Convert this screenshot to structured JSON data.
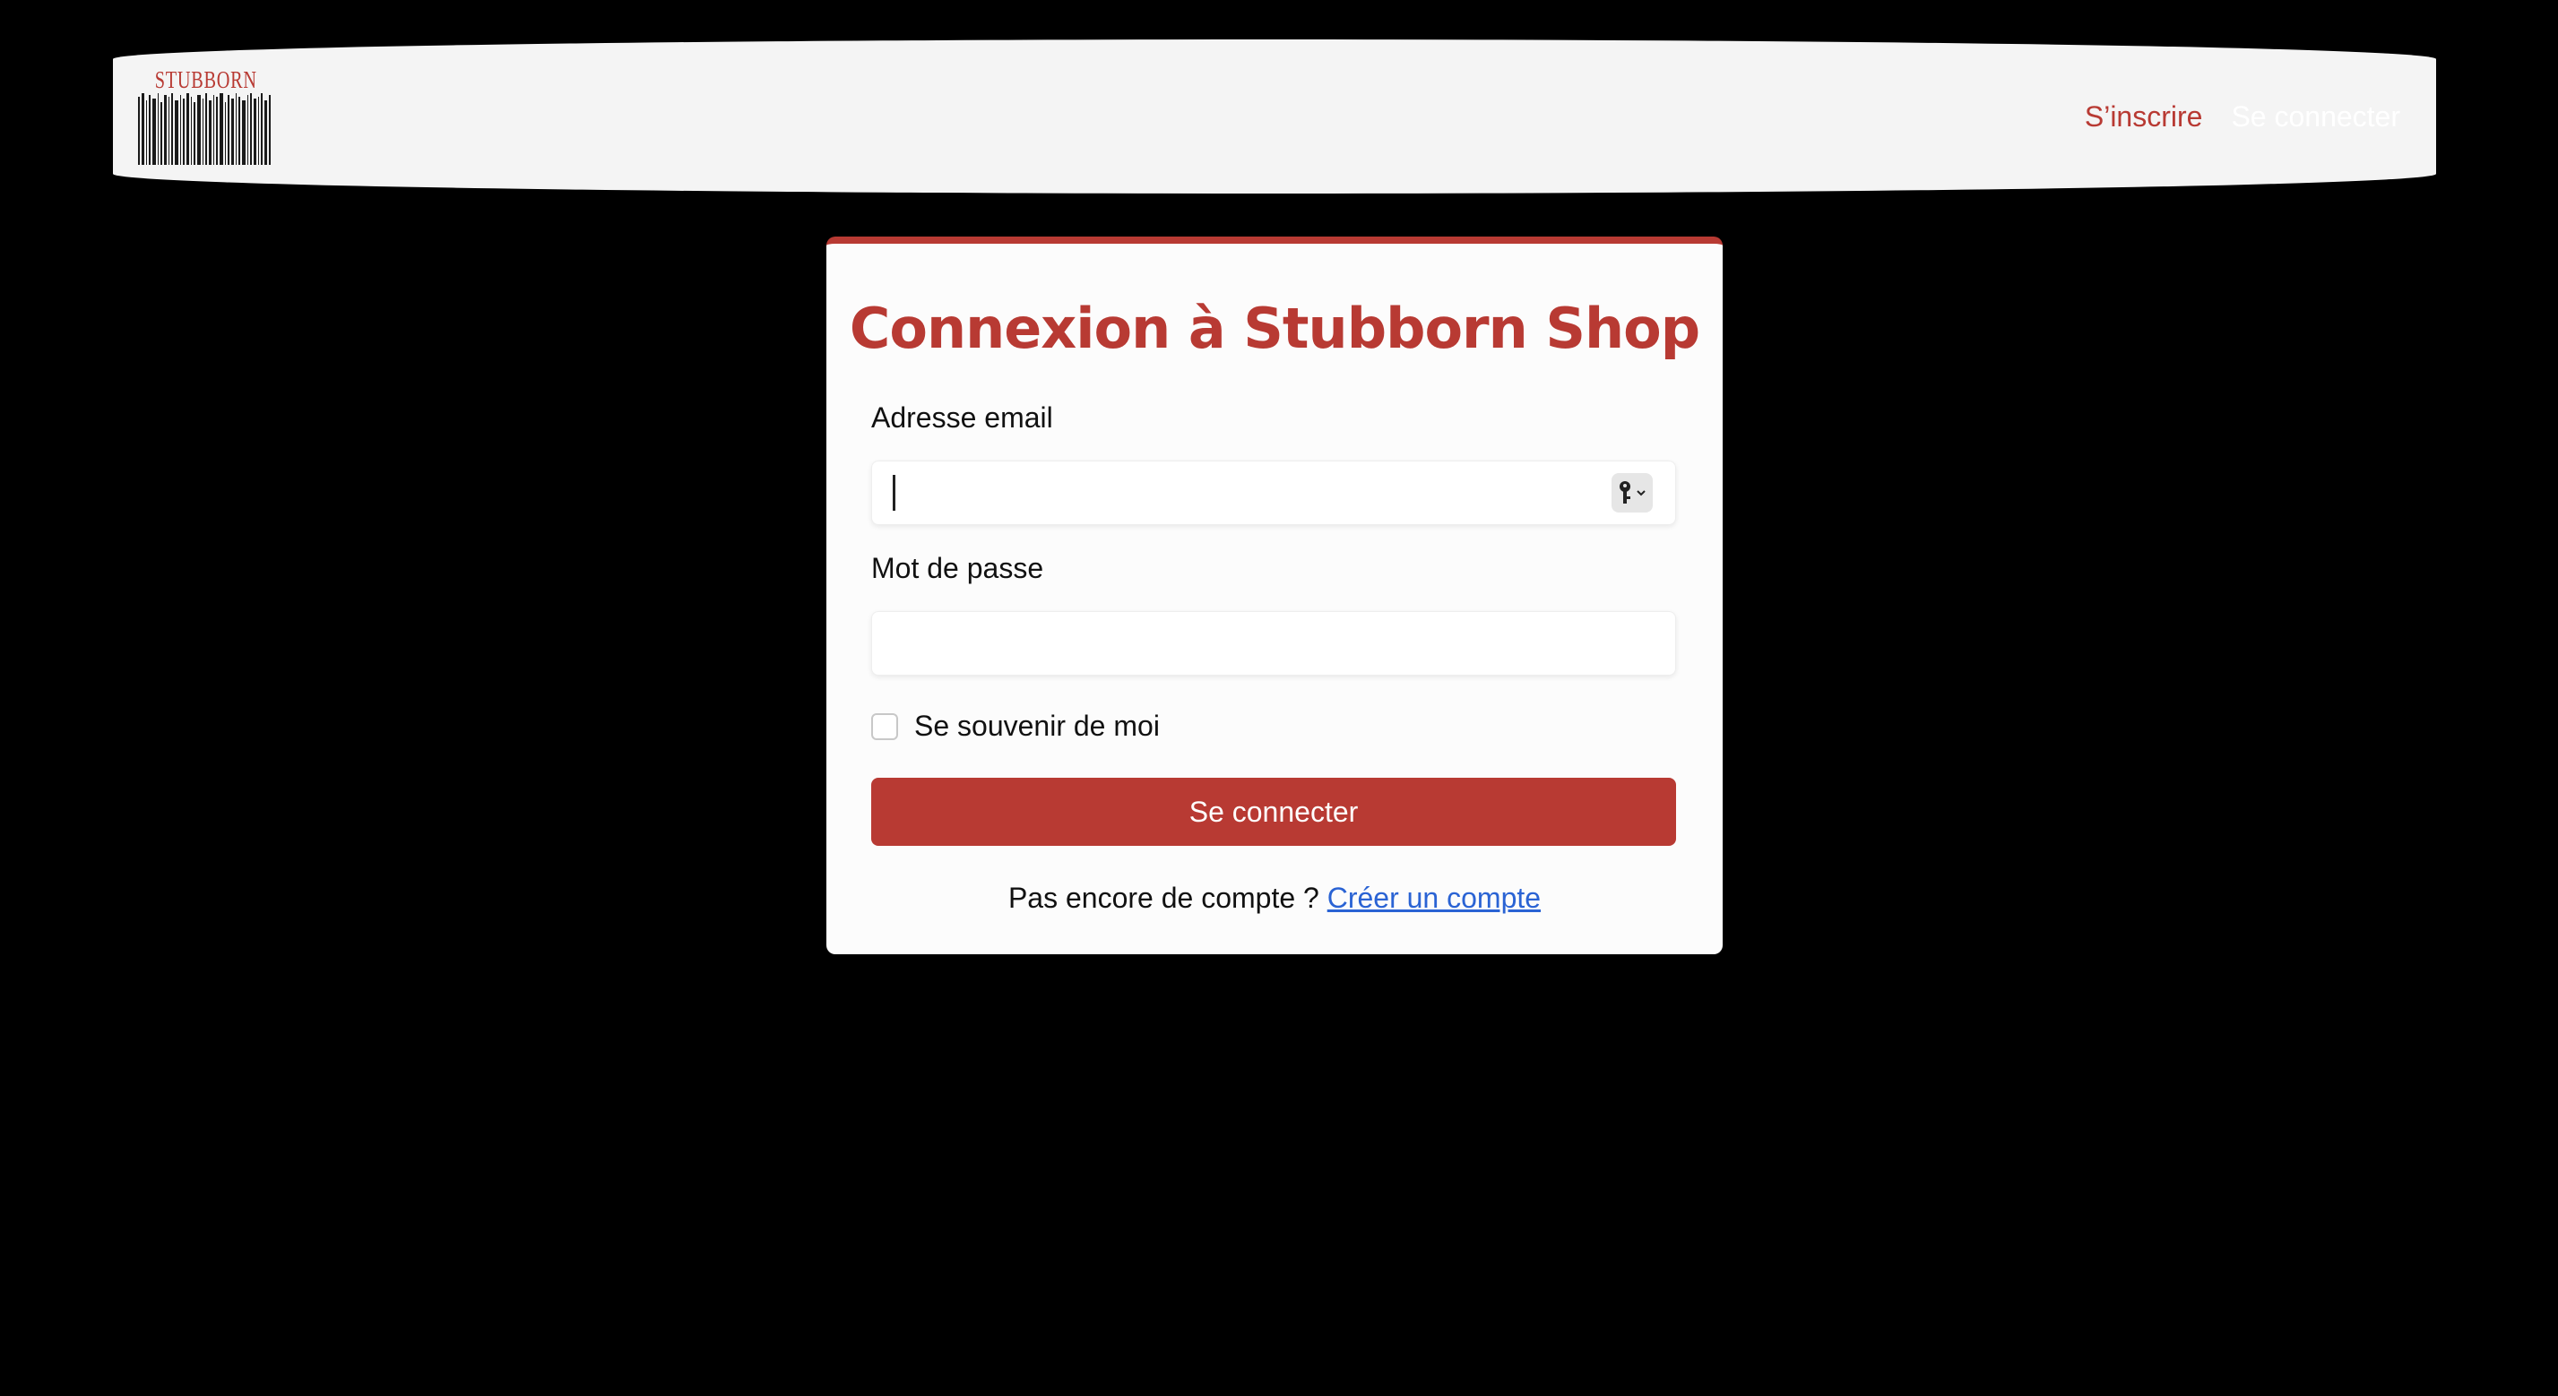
{
  "header": {
    "logo_text": "STUBBORN",
    "nav": {
      "signup_label": "S’inscrire",
      "login_label": "Se connecter"
    }
  },
  "login_form": {
    "title": "Connexion à Stubborn Shop",
    "email": {
      "label": "Adresse email",
      "value": ""
    },
    "password": {
      "label": "Mot de passe",
      "value": ""
    },
    "remember_me": {
      "label": "Se souvenir de moi",
      "checked": false
    },
    "submit_label": "Se connecter",
    "signup_prompt": "Pas encore de compte ?",
    "signup_link": "Créer un compte"
  },
  "colors": {
    "accent": "#b83a33",
    "link": "#2a63d4",
    "page_background": "#000000",
    "navbar_background": "#f4f4f4"
  },
  "icons": {
    "password_manager": "key-icon",
    "dropdown": "chevron-down-icon"
  }
}
